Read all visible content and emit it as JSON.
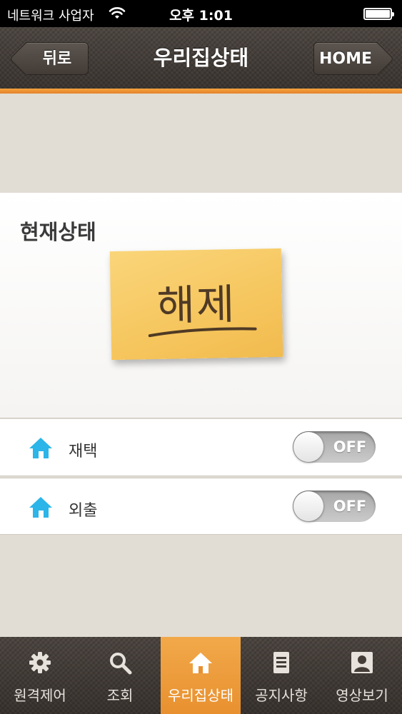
{
  "status_bar": {
    "carrier": "네트워크 사업자",
    "time": "오후 1:01"
  },
  "nav": {
    "title": "우리집상태",
    "back_label": "뒤로",
    "home_label": "HOME"
  },
  "status_panel": {
    "title": "현재상태",
    "state_text": "해제"
  },
  "modes": [
    {
      "label": "재택",
      "toggle": "OFF",
      "icon": "home-icon"
    },
    {
      "label": "외출",
      "toggle": "OFF",
      "icon": "home-icon"
    }
  ],
  "tabs": [
    {
      "label": "원격제어",
      "icon": "gear-icon"
    },
    {
      "label": "조회",
      "icon": "search-icon"
    },
    {
      "label": "우리집상태",
      "icon": "home-icon",
      "active": true
    },
    {
      "label": "공지사항",
      "icon": "document-icon"
    },
    {
      "label": "영상보기",
      "icon": "person-icon"
    }
  ],
  "colors": {
    "accent": "#e8902f",
    "nav_background": "#433c37",
    "home_icon": "#2bb5e8",
    "sticky_note": "#f6c65e"
  }
}
